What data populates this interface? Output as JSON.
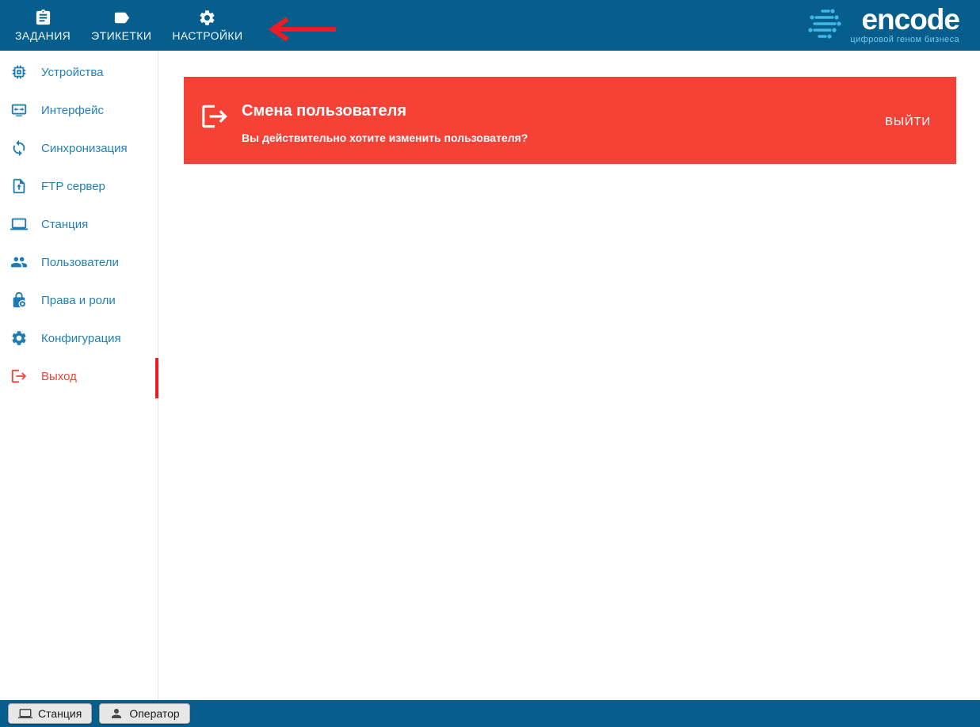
{
  "topbar": {
    "tabs": [
      {
        "label": "ЗАДАНИЯ",
        "icon": "clipboard-icon",
        "active": false
      },
      {
        "label": "ЭТИКЕТКИ",
        "icon": "label-icon",
        "active": false
      },
      {
        "label": "НАСТРОЙКИ",
        "icon": "gear-icon",
        "active": true
      }
    ],
    "active_tab": "НАСТРОЙКИ",
    "logo": {
      "name": "encode",
      "tagline": "цифровой геном бизнеса"
    }
  },
  "sidebar": {
    "items": [
      {
        "label": "Устройства",
        "icon": "chip-icon"
      },
      {
        "label": "Интерфейс",
        "icon": "interface-monitor-icon"
      },
      {
        "label": "Синхронизация",
        "icon": "sync-icon"
      },
      {
        "label": "FTP сервер",
        "icon": "file-upload-icon"
      },
      {
        "label": "Станция",
        "icon": "laptop-icon"
      },
      {
        "label": "Пользователи",
        "icon": "users-icon"
      },
      {
        "label": "Права и роли",
        "icon": "lock-badge-icon"
      },
      {
        "label": "Конфигурация",
        "icon": "gear-icon"
      },
      {
        "label": "Выход",
        "icon": "logout-icon",
        "danger": true
      }
    ]
  },
  "main": {
    "banner": {
      "title": "Смена пользователя",
      "message": "Вы действительно хотите изменить пользователя?",
      "action": "ВЫЙТИ",
      "icon": "logout-icon"
    }
  },
  "statusbar": {
    "chips": [
      {
        "label": "Станция",
        "icon": "laptop-icon"
      },
      {
        "label": "Оператор",
        "icon": "person-icon"
      }
    ]
  },
  "annotations": {
    "arrow_color": "#EC1C24",
    "targets": [
      "НАСТРОЙКИ",
      "Выход"
    ]
  },
  "colors": {
    "topbar_bg": "#055E8C",
    "banner_bg": "#F44336",
    "sidebar_link": "#2181B8",
    "danger_red": "#F44336",
    "annotation_red": "#EC1C24",
    "logo_blue": "#41B6E6",
    "active_tab_underline": "#CDD6DC",
    "chip_bg": "#E7E7E7"
  }
}
